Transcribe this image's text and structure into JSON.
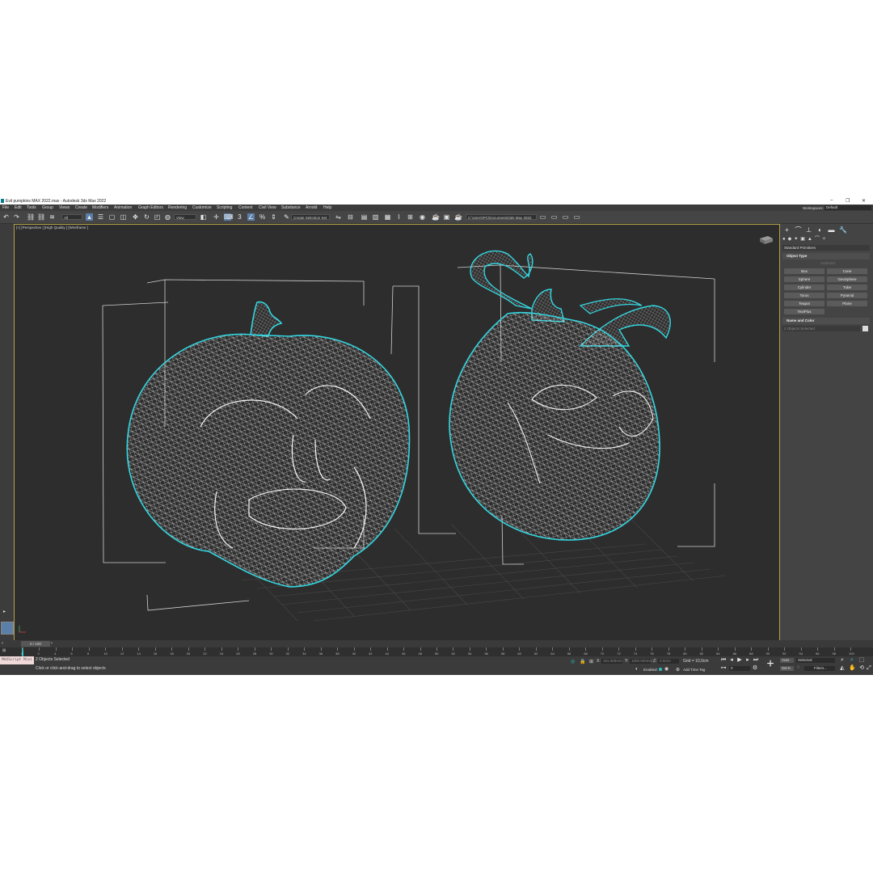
{
  "window": {
    "title": "Evil pumpkins MAX 2022.max - Autodesk 3ds Max 2022",
    "controls": [
      "–",
      "❐",
      "✕"
    ]
  },
  "menubar": {
    "items": [
      "File",
      "Edit",
      "Tools",
      "Group",
      "Views",
      "Create",
      "Modifiers",
      "Animation",
      "Graph Editors",
      "Rendering",
      "Customize",
      "Scripting",
      "Content",
      "Civil View",
      "Substance",
      "Arnold",
      "Help"
    ],
    "workspaces_label": "Workspaces:",
    "workspace_value": "Default"
  },
  "toolbar": {
    "selection_filter": "All",
    "reference_coord": "View",
    "named_selection": "Create Selection Set",
    "project_path": "C:\\Users\\PC\\Documents\\3ds Max 2022"
  },
  "viewport": {
    "label": "[+] [Perspective ] [High Quality ] [Wireframe ]"
  },
  "command_panel": {
    "category": "Standard Primitives",
    "object_type_title": "Object Type",
    "autogrid_label": "AutoGrid",
    "buttons": [
      "Box",
      "Cone",
      "Sphere",
      "GeoSphere",
      "Cylinder",
      "Tube",
      "Torus",
      "Pyramid",
      "Teapot",
      "Plane",
      "TextPlus"
    ],
    "name_color_title": "Name and Color",
    "name_value": "2 Objects Selected"
  },
  "timeline": {
    "slider_label": "0 / 100",
    "ticks": [
      "0",
      "2",
      "4",
      "6",
      "8",
      "10",
      "12",
      "14",
      "16",
      "18",
      "20",
      "22",
      "24",
      "26",
      "28",
      "30",
      "32",
      "34",
      "36",
      "38",
      "40",
      "42",
      "44",
      "46",
      "48",
      "50",
      "52",
      "54",
      "56",
      "58",
      "60",
      "62",
      "64",
      "66",
      "68",
      "70",
      "72",
      "74",
      "76",
      "78",
      "80",
      "82",
      "84",
      "86",
      "88",
      "90",
      "92",
      "94",
      "96",
      "98",
      "100"
    ]
  },
  "status": {
    "maxscript": "MAXScript Mini",
    "selection_info": "2 Objects Selected",
    "prompt": "Click or click-and-drag to select objects",
    "x_label": "X:",
    "x_value": "191.000mm",
    "y_label": "Y:",
    "y_value": "1000.000mm",
    "z_label": "Z:",
    "z_value": "0.0mm",
    "grid": "Grid = 10,0cm",
    "enabled_label": "Enabled:",
    "add_time_tag": "Add Time Tag",
    "frame_value": "0",
    "auto_label": "Auto",
    "set_key_label": "Set K.",
    "key_filter_select": "Selected",
    "filters_label": "Filters..."
  },
  "colors": {
    "accent_selection": "#33d6e0",
    "wireframe": "#e6e6e6",
    "viewport_bg": "#2d2d2d",
    "active_border": "#b2a04a"
  }
}
